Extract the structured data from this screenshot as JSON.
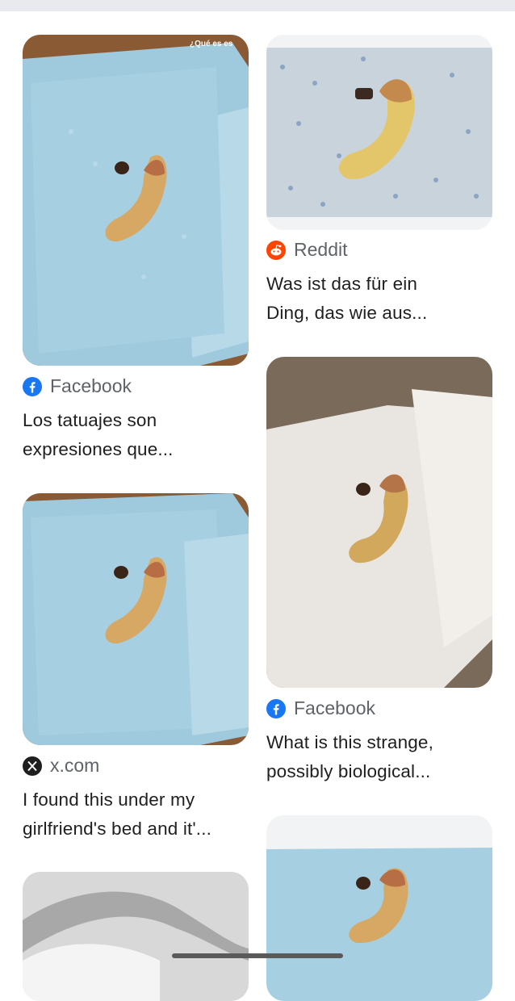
{
  "results": [
    {
      "id": "r1",
      "source": "Facebook",
      "source_icon": "facebook-icon",
      "title": "Los tatuajes son\nexpresiones que...",
      "overlay": "¿Qué es es",
      "image_desc": "blue-towel"
    },
    {
      "id": "r2",
      "source": "Reddit",
      "source_icon": "reddit-icon",
      "title": "Was ist das für ein\nDing, das wie aus...",
      "image_desc": "blue-towel-closeup"
    },
    {
      "id": "r3",
      "source": "x.com",
      "source_icon": "x-icon",
      "title": "I found this under my\ngirlfriend's bed and it'...",
      "image_desc": "blue-towel"
    },
    {
      "id": "r4",
      "source": "Facebook",
      "source_icon": "facebook-icon",
      "title": "What is this strange,\npossibly biological...",
      "image_desc": "white-towel"
    }
  ],
  "colors": {
    "facebook": "#1877f2",
    "reddit": "#ff4500",
    "x": "#1f1f1f",
    "blue_towel": "#a9cfe0",
    "white_towel": "#ece8e3",
    "wood": "#8a5a34"
  }
}
